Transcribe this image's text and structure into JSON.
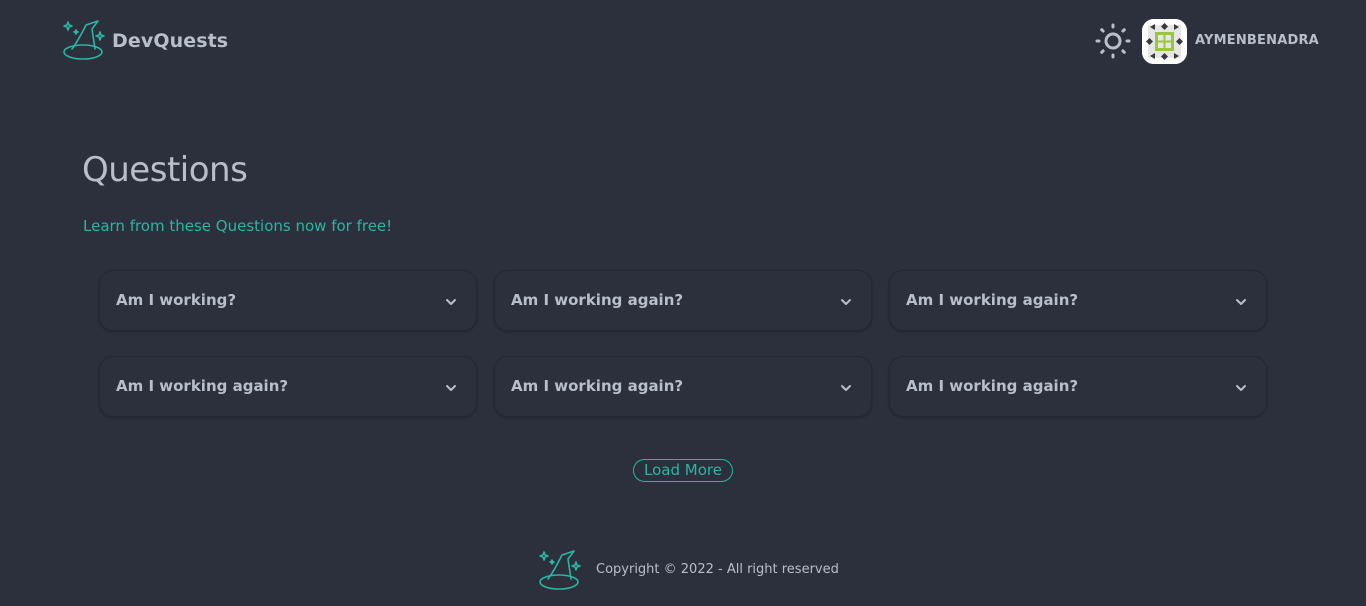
{
  "header": {
    "brand_name": "DevQuests",
    "brand_logo_icon": "wizard-hat-icon",
    "theme_toggle_icon": "sun-icon",
    "username": "AYMENBENADRA"
  },
  "main": {
    "title": "Questions",
    "subtitle": "Learn from these Questions now for free!",
    "questions": [
      {
        "text": "Am I working?"
      },
      {
        "text": "Am I working again?"
      },
      {
        "text": "Am I working again?"
      },
      {
        "text": "Am I working again?"
      },
      {
        "text": "Am I working again?"
      },
      {
        "text": "Am I working again?"
      }
    ],
    "load_more_label": "Load More"
  },
  "footer": {
    "copyright": "Copyright © 2022 - All right reserved"
  },
  "colors": {
    "background": "#2b303c",
    "accent": "#2bb5a2",
    "text": "#b9bfca"
  }
}
